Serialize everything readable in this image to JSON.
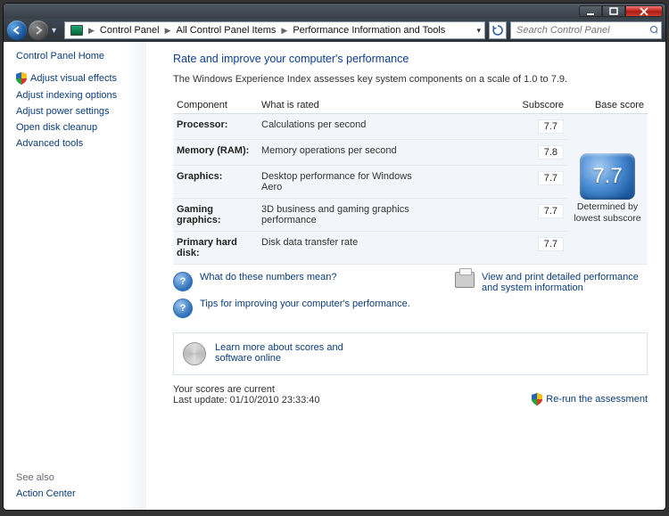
{
  "breadcrumb": {
    "p1": "Control Panel",
    "p2": "All Control Panel Items",
    "p3": "Performance Information and Tools"
  },
  "search": {
    "placeholder": "Search Control Panel"
  },
  "sidebar": {
    "home": "Control Panel Home",
    "links": [
      "Adjust visual effects",
      "Adjust indexing options",
      "Adjust power settings",
      "Open disk cleanup",
      "Advanced tools"
    ],
    "see_also_label": "See also",
    "see_also_link": "Action Center"
  },
  "main": {
    "title": "Rate and improve your computer's performance",
    "desc": "The Windows Experience Index assesses key system components on a scale of 1.0 to 7.9.",
    "cols": {
      "c1": "Component",
      "c2": "What is rated",
      "c3": "Subscore",
      "c4": "Base score"
    },
    "rows": [
      {
        "comp": "Processor:",
        "rated": "Calculations per second",
        "sub": "7.7"
      },
      {
        "comp": "Memory (RAM):",
        "rated": "Memory operations per second",
        "sub": "7.8"
      },
      {
        "comp": "Graphics:",
        "rated": "Desktop performance for Windows Aero",
        "sub": "7.7"
      },
      {
        "comp": "Gaming graphics:",
        "rated": "3D business and gaming graphics performance",
        "sub": "7.7"
      },
      {
        "comp": "Primary hard disk:",
        "rated": "Disk data transfer rate",
        "sub": "7.7"
      }
    ],
    "base_score": "7.7",
    "base_caption": "Determined by lowest subscore",
    "help1": "What do these numbers mean?",
    "help2": "Tips for improving your computer's performance.",
    "help3": "View and print detailed performance and system information",
    "learn": "Learn more about scores and software online",
    "status_current": "Your scores are current",
    "status_updated": "Last update: 01/10/2010 23:33:40",
    "rerun": "Re-run the assessment"
  }
}
